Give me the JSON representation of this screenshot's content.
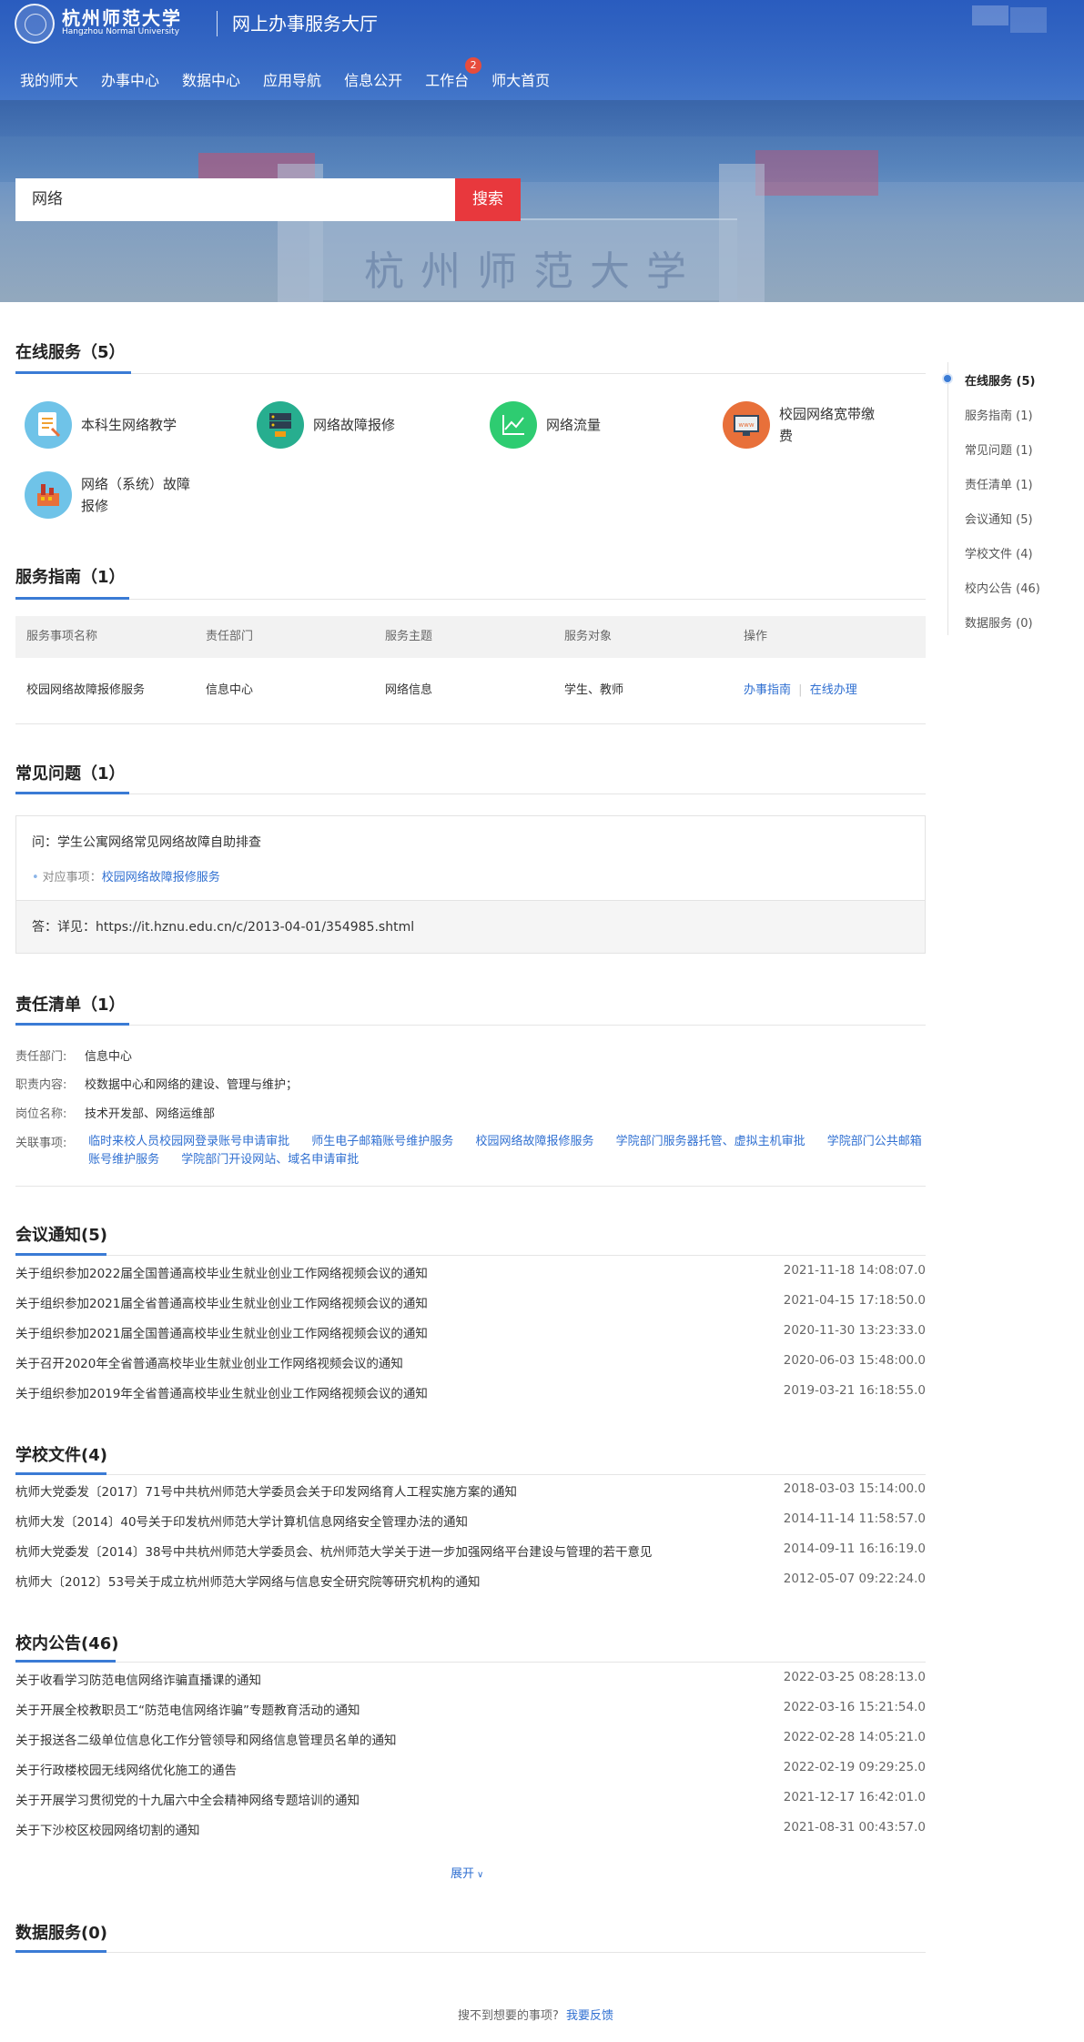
{
  "header": {
    "uni_name_cn": "杭州师范大学",
    "uni_name_en": "Hangzhou Normal University",
    "site_title": "网上办事服务大厅",
    "nav": [
      "我的师大",
      "办事中心",
      "数据中心",
      "应用导航",
      "信息公开",
      "工作台",
      "师大首页"
    ],
    "workbench_badge": "2"
  },
  "search": {
    "value": "网络",
    "button": "搜索"
  },
  "online_services": {
    "title": "在线服务（5）",
    "items": [
      {
        "label": "本科生网络教学",
        "icon": "document-icon",
        "color": "#6fc3e8"
      },
      {
        "label": "网络故障报修",
        "icon": "server-icon",
        "color": "#27ae8f"
      },
      {
        "label": "网络流量",
        "icon": "chart-line-icon",
        "color": "#2ecc71"
      },
      {
        "label": "校园网络宽带缴费",
        "icon": "monitor-www-icon",
        "color": "#e8703a"
      },
      {
        "label": "网络（系统）故障报修",
        "icon": "factory-icon",
        "color": "#6fc3e8"
      }
    ]
  },
  "guide": {
    "title": "服务指南（1）",
    "headers": [
      "服务事项名称",
      "责任部门",
      "服务主题",
      "服务对象",
      "操作"
    ],
    "rows": [
      {
        "name": "校园网络故障报修服务",
        "dept": "信息中心",
        "topic": "网络信息",
        "target": "学生、教师",
        "op1": "办事指南",
        "op2": "在线办理"
      }
    ]
  },
  "faq": {
    "title": "常见问题（1）",
    "question": "问：学生公寓网络常见网络故障自助排查",
    "related_label": "对应事项：",
    "related_link": "校园网络故障报修服务",
    "answer": "答：详见：https://it.hznu.edu.cn/c/2013-04-01/354985.shtml"
  },
  "responsibility": {
    "title": "责任清单（1）",
    "dept_label": "责任部门:",
    "dept": "信息中心",
    "duty_label": "职责内容:",
    "duty": "校数据中心和网络的建设、管理与维护；",
    "post_label": "岗位名称:",
    "post": "技术开发部、网络运维部",
    "related_label": "关联事项:",
    "related": [
      "临时来校人员校园网登录账号申请审批",
      "师生电子邮箱账号维护服务",
      "校园网络故障报修服务",
      "学院部门服务器托管、虚拟主机审批",
      "学院部门公共邮箱账号维护服务",
      "学院部门开设网站、域名申请审批"
    ]
  },
  "meetings": {
    "title": "会议通知(5)",
    "items": [
      {
        "title": "关于组织参加2022届全国普通高校毕业生就业创业工作网络视频会议的通知",
        "date": "2021-11-18 14:08:07.0"
      },
      {
        "title": "关于组织参加2021届全省普通高校毕业生就业创业工作网络视频会议的通知",
        "date": "2021-04-15 17:18:50.0"
      },
      {
        "title": "关于组织参加2021届全国普通高校毕业生就业创业工作网络视频会议的通知",
        "date": "2020-11-30 13:23:33.0"
      },
      {
        "title": "关于召开2020年全省普通高校毕业生就业创业工作网络视频会议的通知",
        "date": "2020-06-03 15:48:00.0"
      },
      {
        "title": "关于组织参加2019年全省普通高校毕业生就业创业工作网络视频会议的通知",
        "date": "2019-03-21 16:18:55.0"
      }
    ]
  },
  "documents": {
    "title": "学校文件(4)",
    "items": [
      {
        "title": "杭师大党委发〔2017〕71号中共杭州师范大学委员会关于印发网络育人工程实施方案的通知",
        "date": "2018-03-03 15:14:00.0"
      },
      {
        "title": "杭师大发〔2014〕40号关于印发杭州师范大学计算机信息网络安全管理办法的通知",
        "date": "2014-11-14 11:58:57.0"
      },
      {
        "title": "杭师大党委发〔2014〕38号中共杭州师范大学委员会、杭州师范大学关于进一步加强网络平台建设与管理的若干意见",
        "date": "2014-09-11 16:16:19.0"
      },
      {
        "title": "杭师大〔2012〕53号关于成立杭州师范大学网络与信息安全研究院等研究机构的通知",
        "date": "2012-05-07 09:22:24.0"
      }
    ]
  },
  "announcements": {
    "title": "校内公告(46)",
    "items": [
      {
        "title": "关于收看学习防范电信网络诈骗直播课的通知",
        "date": "2022-03-25 08:28:13.0"
      },
      {
        "title": "关于开展全校教职员工“防范电信网络诈骗”专题教育活动的通知",
        "date": "2022-03-16 15:21:54.0"
      },
      {
        "title": "关于报送各二级单位信息化工作分管领导和网络信息管理员名单的通知",
        "date": "2022-02-28 14:05:21.0"
      },
      {
        "title": "关于行政楼校园无线网络优化施工的通告",
        "date": "2022-02-19 09:29:25.0"
      },
      {
        "title": "关于开展学习贯彻党的十九届六中全会精神网络专题培训的通知",
        "date": "2021-12-17 16:42:01.0"
      },
      {
        "title": "关于下沙校区校园网络切割的通知",
        "date": "2021-08-31 00:43:57.0"
      }
    ],
    "expand": "展开"
  },
  "data_services": {
    "title": "数据服务(0)"
  },
  "footer": {
    "text": "搜不到想要的事项?",
    "link": "我要反馈"
  },
  "sidebar": [
    "在线服务 (5)",
    "服务指南 (1)",
    "常见问题 (1)",
    "责任清单 (1)",
    "会议通知 (5)",
    "学校文件 (4)",
    "校内公告 (46)",
    "数据服务 (0)"
  ]
}
